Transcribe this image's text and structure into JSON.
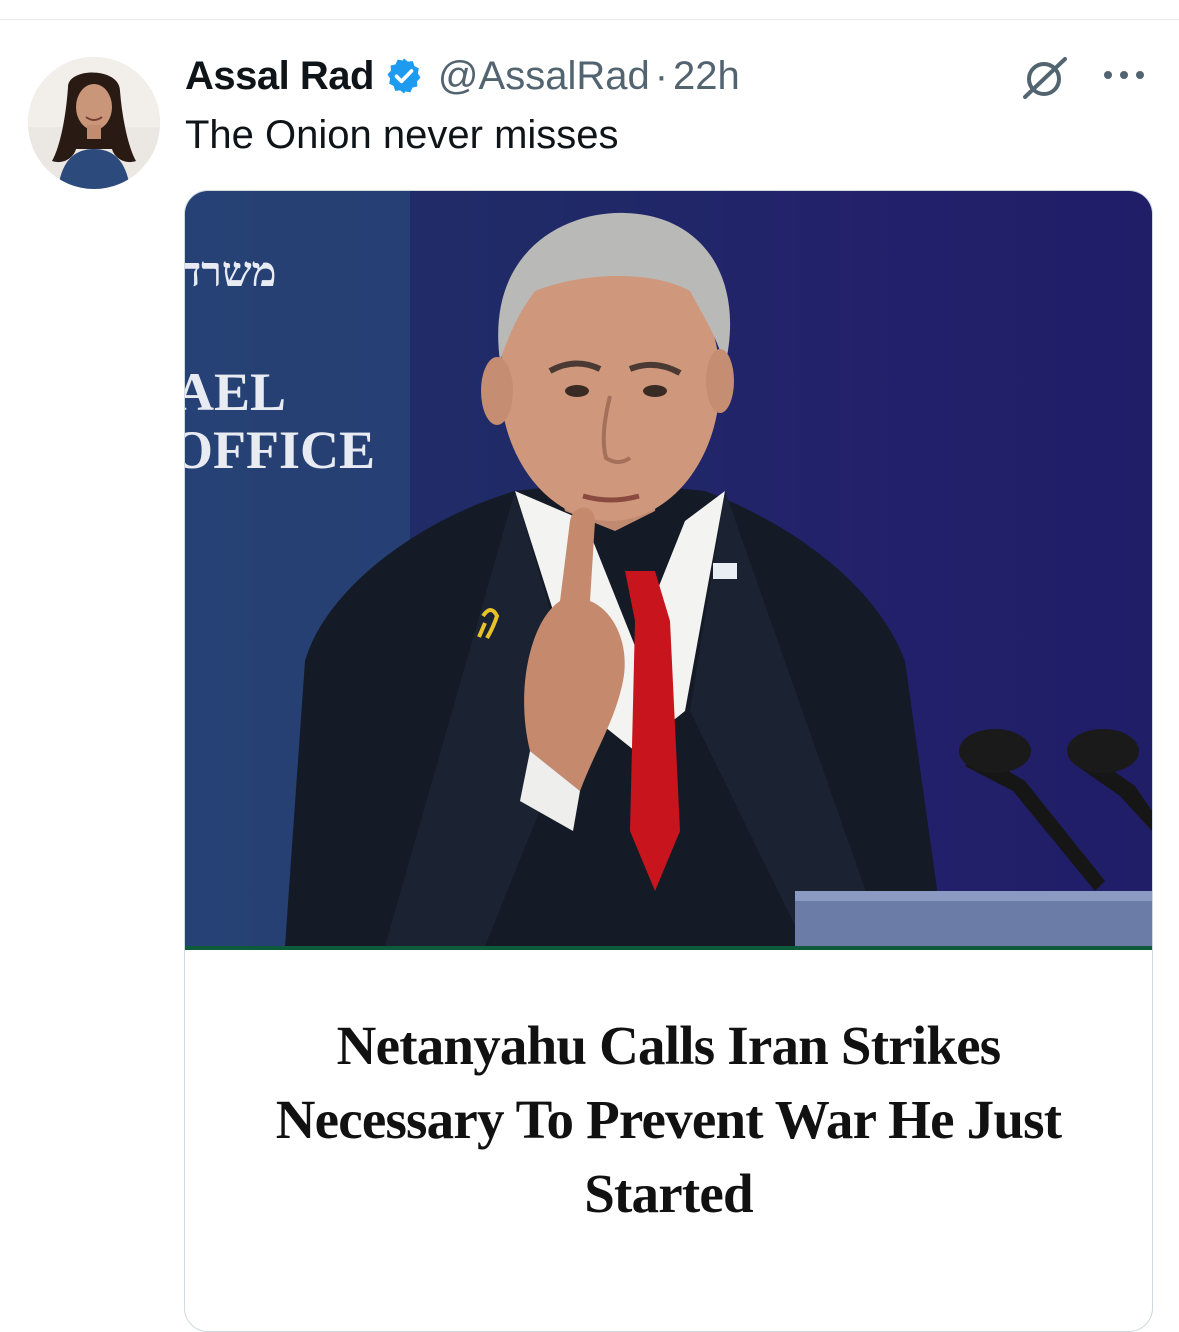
{
  "tweet": {
    "author": {
      "display_name": "Assal Rad",
      "handle": "@AssalRad",
      "verified": true,
      "avatar_icon": "profile-photo"
    },
    "separator": "·",
    "timestamp": "22h",
    "text": "The Onion never misses",
    "actions": {
      "grok_icon": "grok-icon",
      "more_icon": "more-options-icon"
    }
  },
  "media": {
    "backdrop_text": {
      "line1": "משרד",
      "line2": "AEL",
      "line3": "OFFICE"
    },
    "headline": "Netanyahu Calls Iran Strikes Necessary To Prevent War He Just Started"
  },
  "colors": {
    "verified_blue": "#1d9bf0",
    "text_primary": "#0f1419",
    "text_secondary": "#536471",
    "accent_green_rule": "#0d5b3b",
    "photo_background": "#1e2f66"
  }
}
